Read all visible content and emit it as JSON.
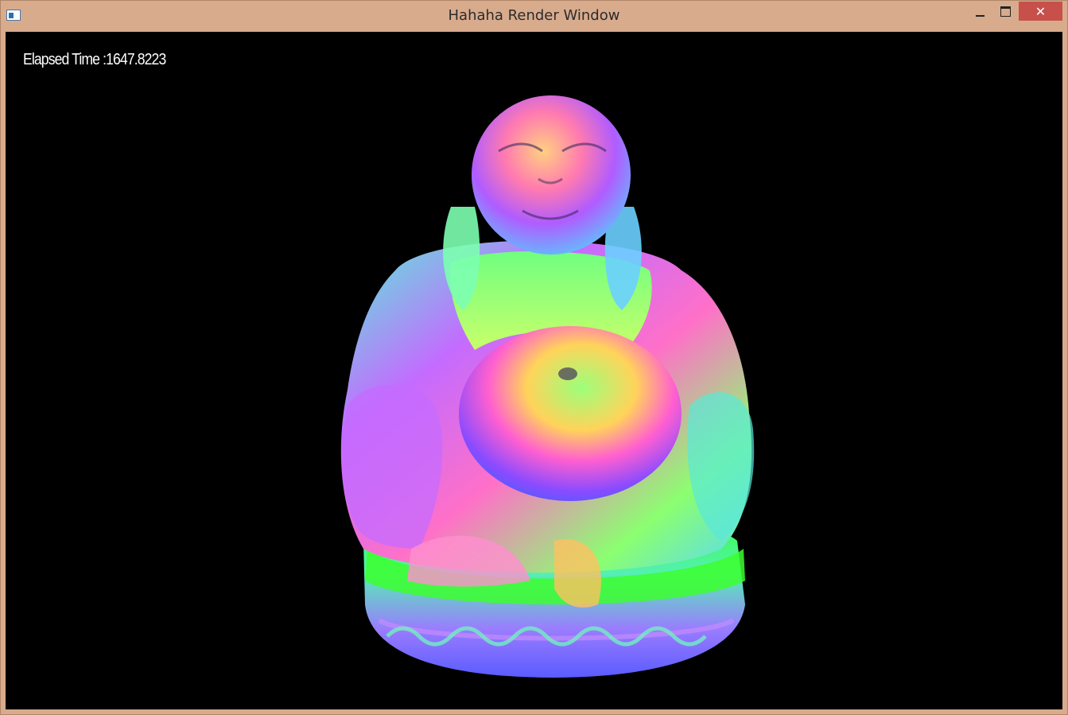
{
  "window": {
    "title": "Hahaha Render Window",
    "close_glyph": "✕"
  },
  "render": {
    "elapsed_label": "Elapsed Time :",
    "elapsed_value": "1647.8223",
    "background": "#000000",
    "subject": "buddha-statue-normal-map"
  }
}
